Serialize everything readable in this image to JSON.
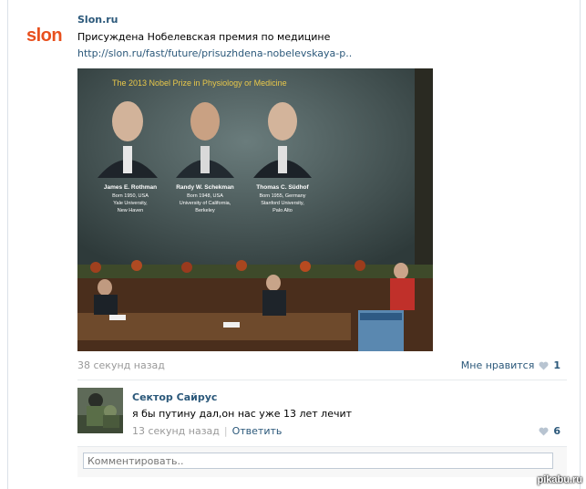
{
  "post": {
    "logo_text": "slon",
    "author": "Slon.ru",
    "text": "Присуждена Нобелевская премия по медицине",
    "link": "http://slon.ru/fast/future/prisuzhdena-nobelevskaya-p..",
    "time": "38 секунд назад",
    "like_label": "Мне нравится",
    "like_count": "1"
  },
  "photo": {
    "slide_title": "The 2013 Nobel Prize in Physiology or Medicine",
    "laureates": [
      {
        "name": "James E. Rothman",
        "info1": "Born 1950, USA",
        "info2": "Yale University,",
        "info3": "New Haven"
      },
      {
        "name": "Randy W. Schekman",
        "info1": "Born 1948, USA",
        "info2": "University of California,",
        "info3": "Berkeley"
      },
      {
        "name": "Thomas C. Südhof",
        "info1": "Born 1955, Germany",
        "info2": "Stanford University,",
        "info3": "Palo Alto"
      }
    ]
  },
  "comment": {
    "author": "Сектор Сайрус",
    "text": "я бы путину дал,он нас уже 13 лет лечит",
    "time": "13 секунд назад",
    "separator": "|",
    "reply_label": "Ответить",
    "like_count": "6"
  },
  "comment_box": {
    "placeholder": "Комментировать.."
  },
  "watermark": "pikabu.ru",
  "colors": {
    "link": "#2b587a",
    "meta": "#999999",
    "logo": "#e8501e",
    "heart": "#b8c4d1"
  }
}
